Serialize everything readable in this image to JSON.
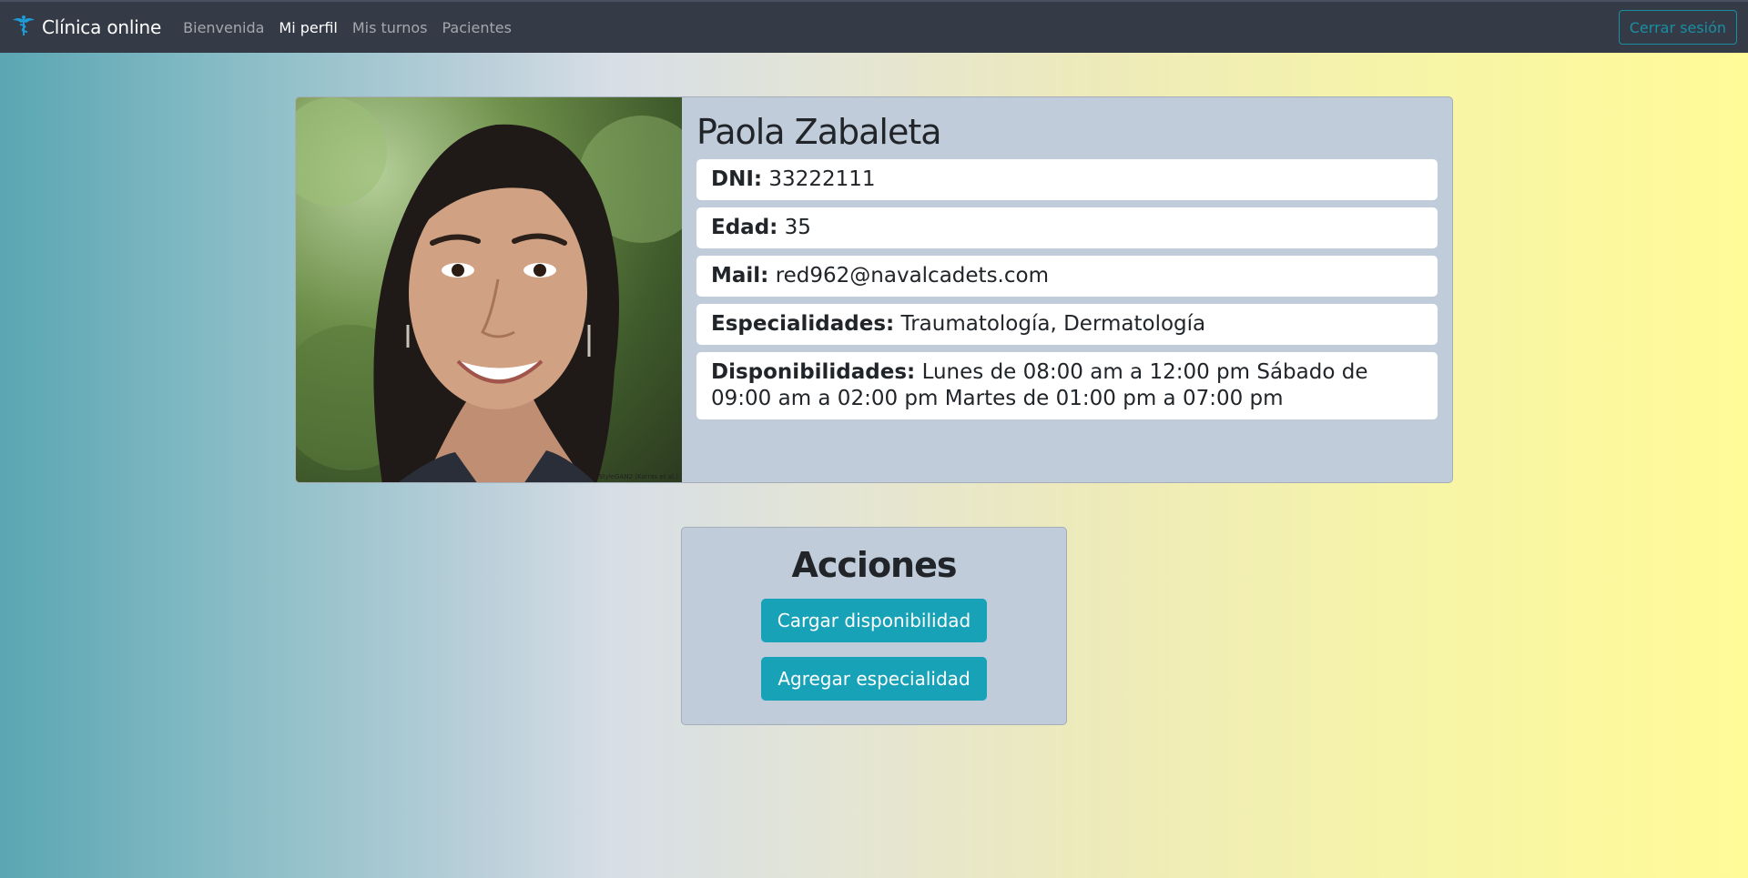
{
  "navbar": {
    "brand": "Clínica online",
    "links": [
      "Bienvenida",
      "Mi perfil",
      "Mis turnos",
      "Pacientes"
    ],
    "active": "Mi perfil",
    "logout_label": "Cerrar sesión"
  },
  "profile": {
    "name": "Paola Zabaleta",
    "photo_credit": "StyleGAN2 (Karras et al.)",
    "fields": [
      {
        "label": "DNI:",
        "value": "33222111"
      },
      {
        "label": "Edad:",
        "value": "35"
      },
      {
        "label": "Mail:",
        "value": "red962@navalcadets.com"
      },
      {
        "label": "Especialidades:",
        "value": "Traumatología, Dermatología"
      },
      {
        "label": "Disponibilidades:",
        "value": "Lunes de 08:00 am a 12:00 pm Sábado de 09:00 am a 02:00 pm Martes de 01:00 pm a 07:00 pm"
      }
    ]
  },
  "actions": {
    "title": "Acciones",
    "buttons": [
      "Cargar disponibilidad",
      "Agregar especialidad"
    ]
  },
  "colors": {
    "navbar_bg": "#343a46",
    "accent": "#17a2b8",
    "card_bg": "#c0ccd9"
  }
}
